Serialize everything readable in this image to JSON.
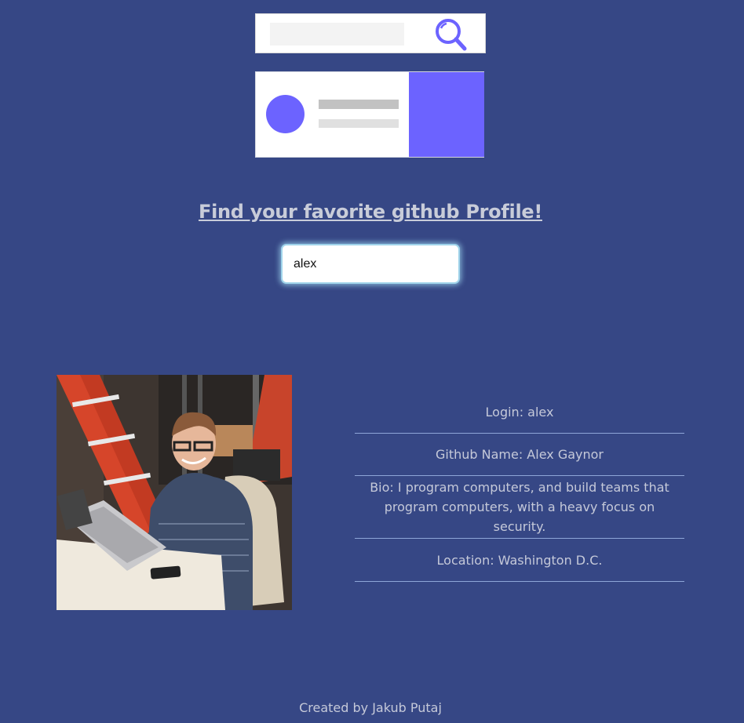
{
  "app": {
    "headline": "Find your favorite github Profile!",
    "footer": "Created by Jakub Putaj"
  },
  "search": {
    "value": "alex",
    "placeholder": ""
  },
  "profile": {
    "login": "Login: alex",
    "name": "Github Name: Alex Gaynor",
    "bio": "Bio: I program computers, and build teams that program computers, with a heavy focus on security.",
    "location": "Location: Washington D.C."
  },
  "colors": {
    "background": "#364785",
    "accent": "#6c63ff",
    "text": "#c5c9d9"
  },
  "icons": {
    "search_illustration": "magnifier-icon",
    "avatar": "profile-photo"
  }
}
